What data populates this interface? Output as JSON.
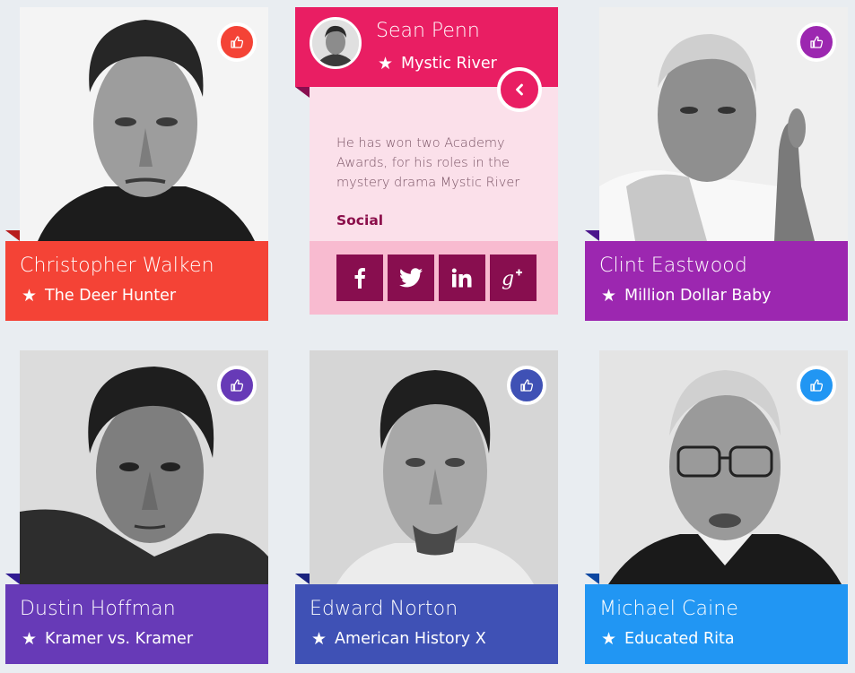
{
  "cards": [
    {
      "name": "Christopher Walken",
      "movie": "The Deer Hunter",
      "color": "#f44336",
      "fold": "#b71c1c",
      "like_color": "#f44336",
      "photo": "walken-portrait"
    },
    {
      "name": "Clint Eastwood",
      "movie": "Million Dollar Baby",
      "color": "#9c27b0",
      "fold": "#4a148c",
      "like_color": "#9c27b0",
      "photo": "eastwood-portrait"
    },
    {
      "name": "Dustin Hoffman",
      "movie": "Kramer vs. Kramer",
      "color": "#673ab7",
      "fold": "#311b92",
      "like_color": "#673ab7",
      "photo": "hoffman-portrait"
    },
    {
      "name": "Edward Norton",
      "movie": "American History X",
      "color": "#3f51b5",
      "fold": "#1a237e",
      "like_color": "#3f51b5",
      "photo": "norton-portrait"
    },
    {
      "name": "Michael Caine",
      "movie": "Educated Rita",
      "color": "#2196f3",
      "fold": "#0d47a1",
      "like_color": "#2196f3",
      "photo": "caine-portrait"
    }
  ],
  "expanded": {
    "name": "Sean Penn",
    "movie": "Mystic River",
    "description": "He has won two Academy Awards, for his roles in the mystery drama Mystic River",
    "social_label": "Social",
    "social_icons": [
      "facebook-icon",
      "twitter-icon",
      "linkedin-icon",
      "google-plus-icon"
    ],
    "color": "#e91e63",
    "fold": "#880e4f",
    "photo": "penn-avatar"
  },
  "icons": {
    "like": "thumbs-up-icon",
    "star": "star-icon",
    "back": "chevron-left-icon"
  }
}
